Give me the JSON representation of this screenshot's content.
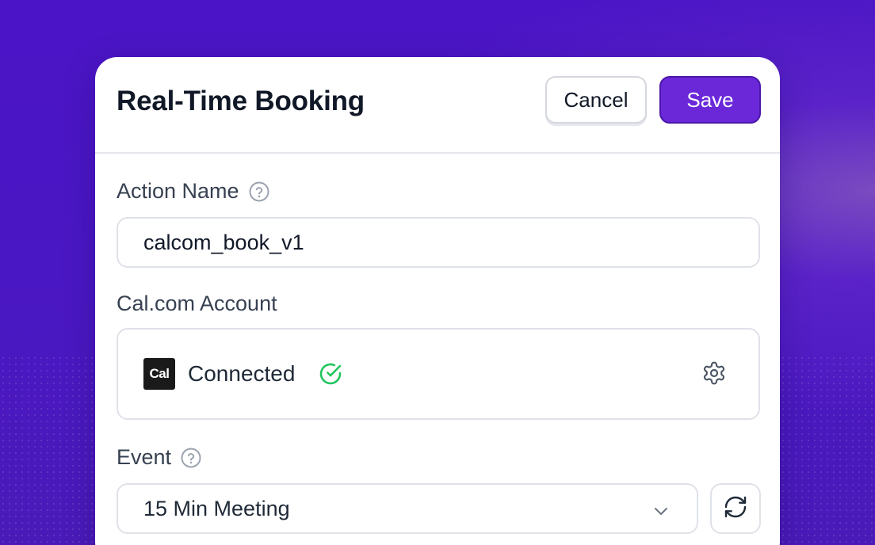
{
  "dialog": {
    "title": "Real-Time Booking",
    "cancel_label": "Cancel",
    "save_label": "Save"
  },
  "action_name": {
    "label": "Action Name",
    "help_icon": "question-circle-icon",
    "value": "calcom_book_v1"
  },
  "account": {
    "label": "Cal.com Account",
    "logo_text": "Cal",
    "status": "Connected",
    "status_icon": "check-circle-icon",
    "settings_icon": "gear-icon"
  },
  "event": {
    "label": "Event",
    "help_icon": "question-circle-icon",
    "selected": "15 Min Meeting",
    "dropdown_icon": "chevron-down-icon",
    "refresh_icon": "refresh-icon"
  },
  "colors": {
    "primary": "#6a28d9",
    "background": "#4b14c6",
    "success": "#22c55e",
    "text": "#111827"
  }
}
